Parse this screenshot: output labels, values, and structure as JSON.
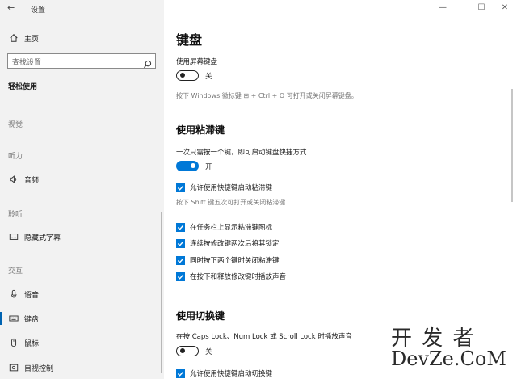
{
  "window": {
    "title": "设置",
    "controls": {
      "minimize": "—",
      "maximize": "☐",
      "close": "✕"
    }
  },
  "sidebar": {
    "home": "主页",
    "search_placeholder": "查找设置",
    "category": "轻松使用",
    "sections": [
      {
        "label": "视觉"
      },
      {
        "label": "听力",
        "items": [
          "音频"
        ]
      },
      {
        "label": "聆听",
        "items": [
          "隐藏式字幕"
        ]
      },
      {
        "label": "交互",
        "items": [
          "语音",
          "键盘",
          "鼠标",
          "目视控制"
        ]
      }
    ],
    "selected": "键盘"
  },
  "main": {
    "title": "键盘",
    "onscreen": {
      "label": "使用屏幕键盘",
      "toggle": "关",
      "toggle_on": false,
      "hint": "按下 Windows 徽标键 ⊞ + Ctrl + O 可打开或关闭屏幕键盘。"
    },
    "sticky": {
      "heading": "使用粘滞键",
      "desc": "一次只需按一个键，即可启动键盘快捷方式",
      "toggle": "开",
      "toggle_on": true,
      "cb_shortcut": "允许使用快捷键启动粘滞键",
      "shortcut_hint": "按下 Shift 键五次可打开或关闭粘滞键",
      "options": [
        "在任务栏上显示粘滞键图标",
        "连续按修改键两次后将其锁定",
        "同时按下两个键时关闭粘滞键",
        "在按下和释放修改键时播放声音"
      ]
    },
    "toggle_keys": {
      "heading": "使用切换键",
      "desc": "在按 Caps Lock、Num Lock 或 Scroll Lock 时播放声音",
      "toggle": "关",
      "toggle_on": false,
      "cb_shortcut": "允许使用快捷键启动切换键"
    }
  },
  "watermark": {
    "top": "开 发 者",
    "bottom": "DevZe.CoM"
  },
  "colors": {
    "accent": "#0078d7",
    "sidebar_bg": "#f2f2f2"
  }
}
